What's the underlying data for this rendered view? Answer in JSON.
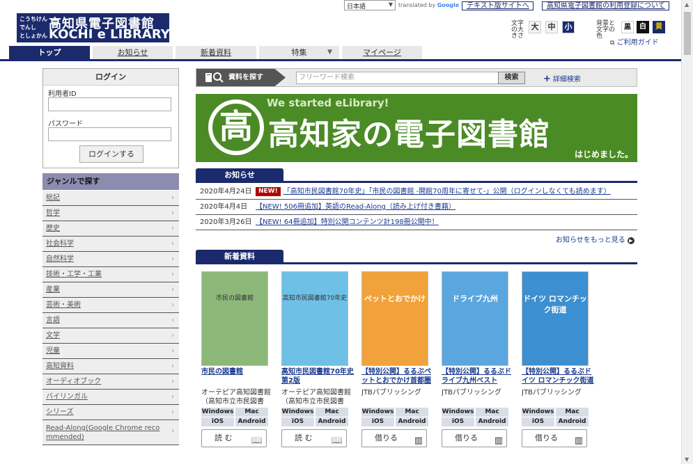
{
  "topbar": {
    "language": "日本語",
    "translated_by": "translated by",
    "google": "Google",
    "text_site_link": "テキスト版サイトへ",
    "register_link": "高知県電子図書館の利用登録について"
  },
  "logo": {
    "kana_1": "こうちけん",
    "kana_2": "でんし",
    "kana_3": "としょかん",
    "title_jp": "高知県電子図書館",
    "title_en": "KOCHI e LIBRARY"
  },
  "font_size": {
    "label": "文字の大きさ",
    "large": "大",
    "medium": "中",
    "small": "小"
  },
  "background": {
    "label": "背景と文字の色",
    "black": "黒",
    "white": "白",
    "yellow": "黄"
  },
  "guide_link": "ご利用ガイド",
  "tabs": [
    "トップ",
    "お知らせ",
    "新着資料",
    "特集",
    "マイページ"
  ],
  "login": {
    "heading": "ログイン",
    "user_id_label": "利用者ID",
    "password_label": "パスワード",
    "button": "ログインする"
  },
  "genre": {
    "heading": "ジャンルで探す",
    "items": [
      "総記",
      "哲学",
      "歴史",
      "社会科学",
      "自然科学",
      "技術・工学・工業",
      "産業",
      "芸術・美術",
      "言語",
      "文学",
      "児童",
      "高知資料",
      "オーディオブック",
      "バイリンガル",
      "シリーズ",
      "Read-Along(Google Chrome recommended)"
    ]
  },
  "search": {
    "label": "資料を探す",
    "placeholder": "フリーワード検索",
    "button": "検索",
    "advanced": "詳細検索"
  },
  "banner": {
    "subtitle": "We started eLibrary!",
    "title": "高知家の電子図書館",
    "tail": "はじめました。",
    "seal_char": "高"
  },
  "news": {
    "heading": "お知らせ",
    "new_badge": "NEW!",
    "items": [
      {
        "date": "2020年4月24日",
        "title": "「高知市民図書館70年史」「市民の図書館 -開館70周年に寄せて-」公開（ログインしなくても読めます）"
      },
      {
        "date": "2020年4月4日",
        "title": "【NEW! 506冊追加】英語のRead-Along（読み上げ付き書籍）"
      },
      {
        "date": "2020年3月26日",
        "title": "【NEW! 64冊追加】特別公開コンテンツ計198冊公開中！"
      }
    ],
    "more": "お知らせをもっと見る"
  },
  "new_arrivals": {
    "heading": "新着資料",
    "badges": [
      "Windows",
      "Mac",
      "iOS",
      "Android"
    ],
    "books": [
      {
        "title": "市民の図書館",
        "publisher": "オーテピア高知図書館（高知市立市民図書館）",
        "button": "読 む",
        "cover_text": "市民の図書館",
        "cover_color": "#8cb87a"
      },
      {
        "title": "高知市民図書館70年史 第2版",
        "publisher": "オーテピア高知図書館（高知市立市民図書館）",
        "button": "読 む",
        "cover_text": "高知市民図書館70年史",
        "cover_color": "#6ec0e6"
      },
      {
        "title": "【特別公開】るるぶペットとおでかけ首都圏",
        "publisher": "JTBパブリッシング",
        "button": "借りる",
        "cover_text": "ペットとおでかけ",
        "cover_color": "#f2a23a"
      },
      {
        "title": "【特別公開】るるぶドライブ九州ベスト",
        "publisher": "JTBパブリッシング",
        "button": "借りる",
        "cover_text": "ドライブ九州",
        "cover_color": "#5aa7e0"
      },
      {
        "title": "【特別公開】るるぶドイツ ロマンチック街道",
        "publisher": "JTBパブリッシング",
        "button": "借りる",
        "cover_text": "ドイツ ロマンチック街道",
        "cover_color": "#3c8fd0"
      }
    ]
  },
  "colors": {
    "navy": "#1a2a6c",
    "banner_green": "#4b8b25",
    "new_red": "#b00000",
    "yellow_bg": "#e8c800"
  }
}
